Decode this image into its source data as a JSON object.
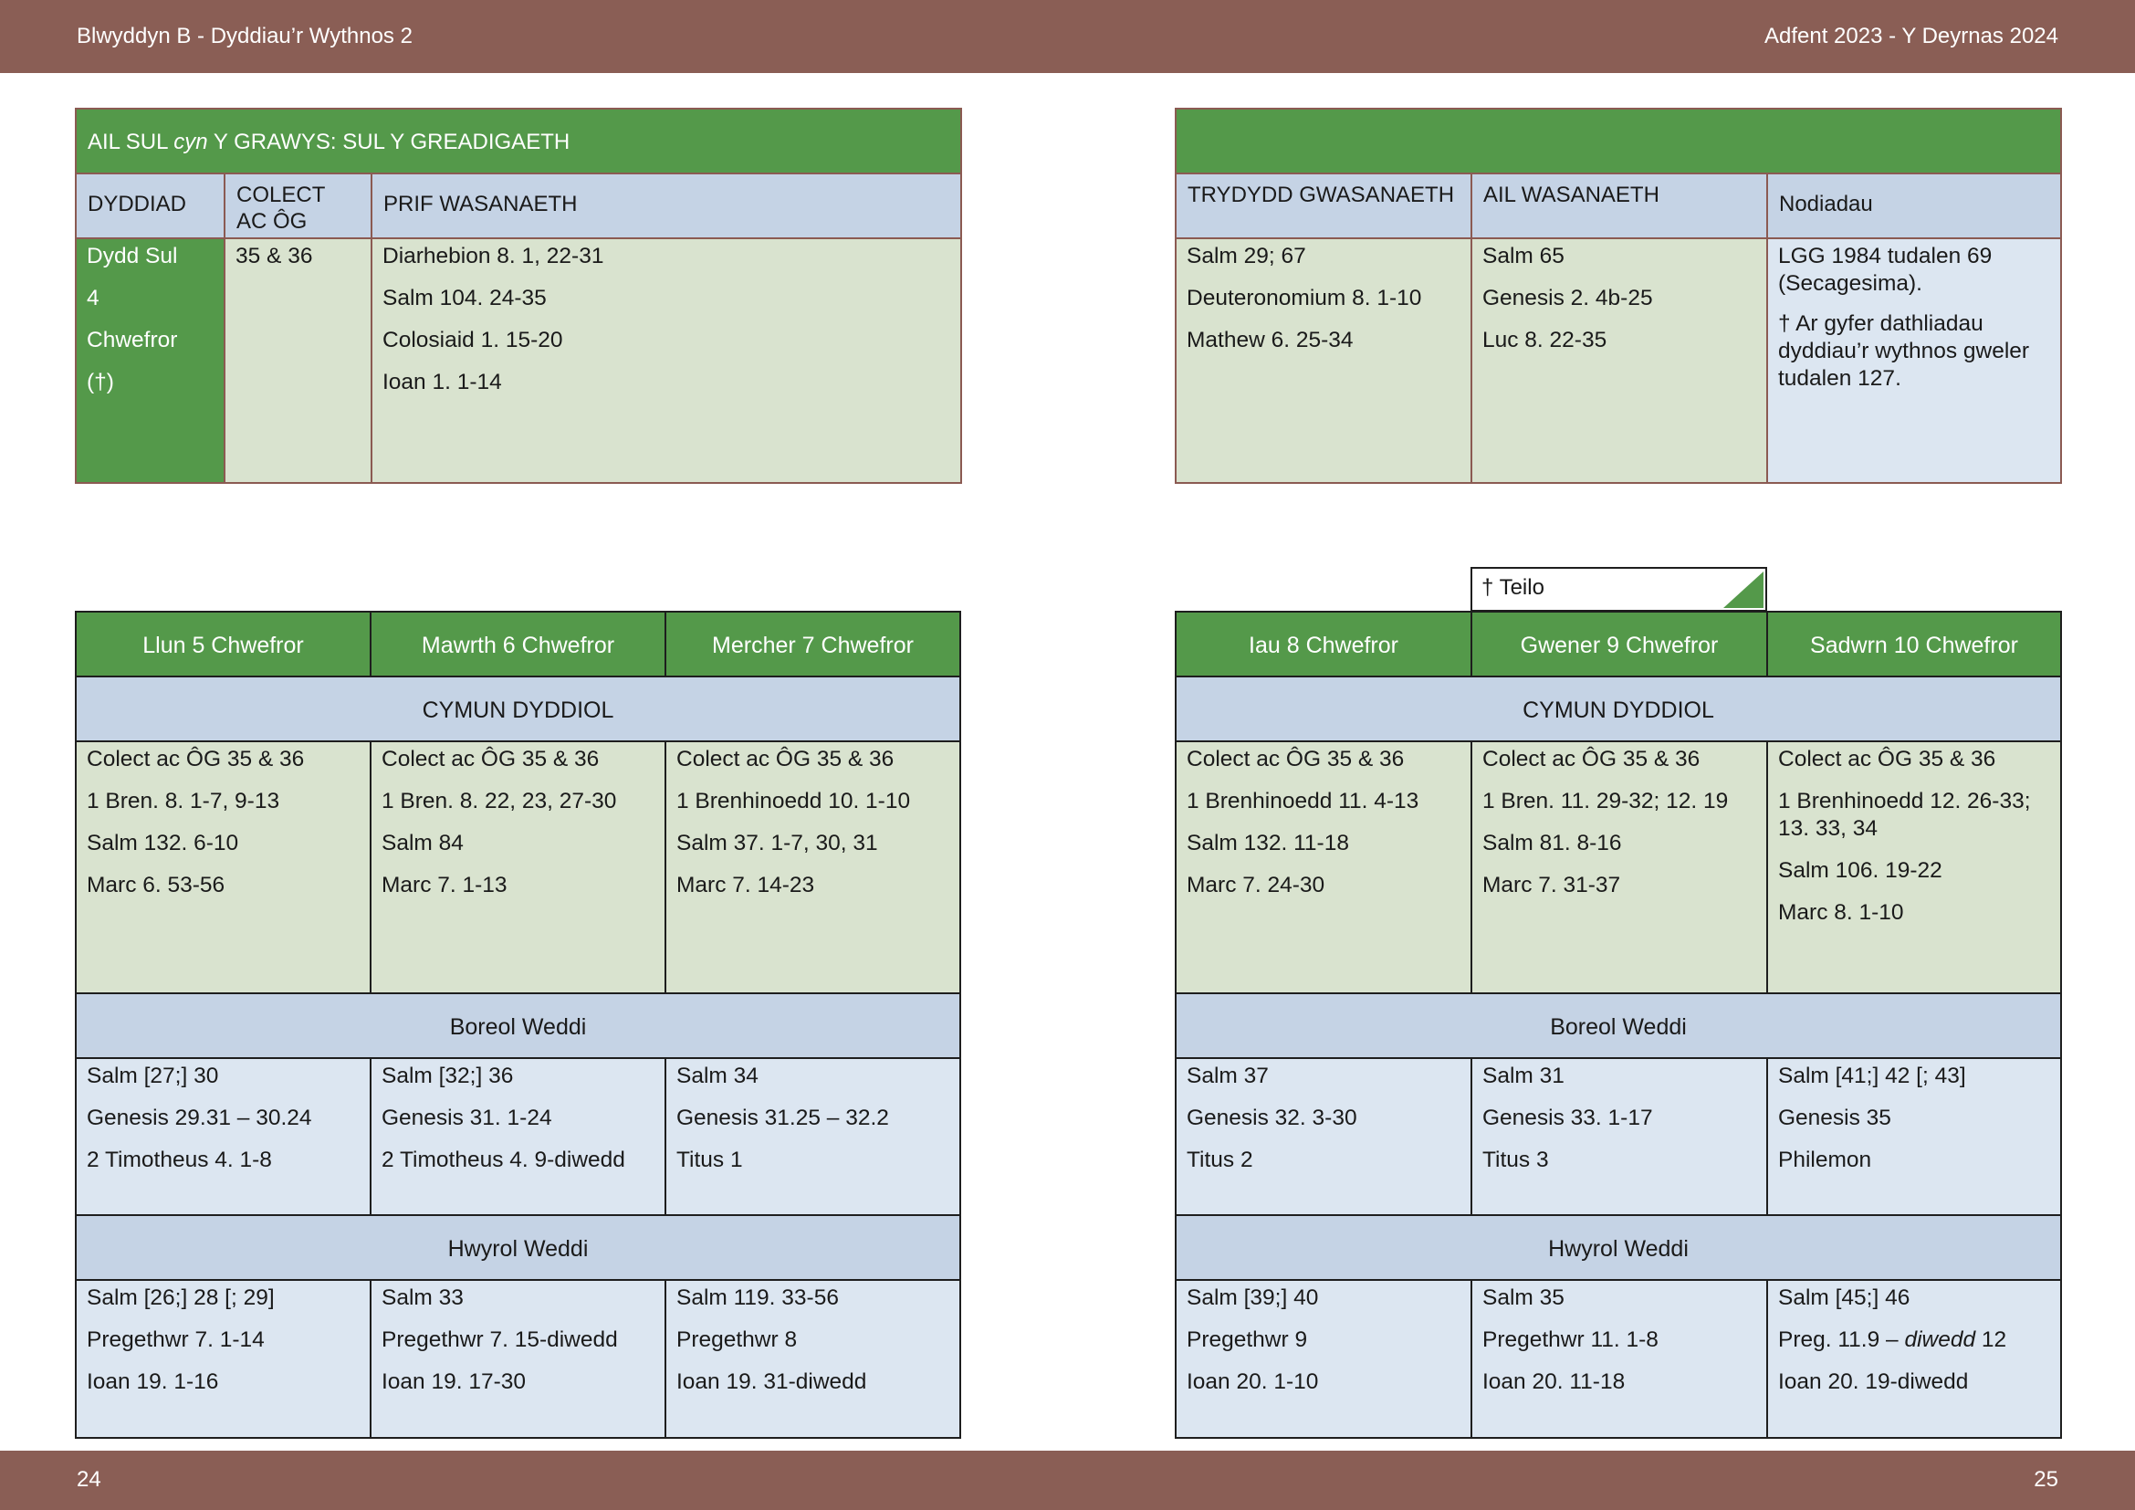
{
  "header": {
    "left": "Blwyddyn  B - Dyddiau’r Wythnos 2",
    "right": "Adfent  2023 - Y Deyrnas 2024"
  },
  "footer": {
    "left": "24",
    "right": "25"
  },
  "sunday": {
    "title_pre": "AIL SUL ",
    "title_em": "cyn",
    "title_post": " Y GRAWYS: SUL Y GREADIGAETH",
    "headers": {
      "date": "DYDDIAD",
      "collect": "COLECT AC ÔG",
      "principal": "PRIF WASANAETH",
      "third": "TRYDYDD GWASANAETH",
      "second": "AIL WASANAETH",
      "notes": "Nodiadau"
    },
    "date_lines": [
      "Dydd Sul",
      "4",
      "Chwefror",
      "(†)"
    ],
    "collect": "35 & 36",
    "principal": [
      "Diarhebion 8. 1, 22-31",
      "Salm 104. 24-35",
      "Colosiaid 1. 15-20",
      "Ioan 1. 1-14"
    ],
    "third": [
      "Salm 29; 67",
      "Deuteronomium 8. 1-10",
      "Mathew 6. 25-34"
    ],
    "second": [
      "Salm 65",
      "Genesis 2. 4b-25",
      "Luc 8. 22-35"
    ],
    "notes": [
      "LGG 1984 tudalen 69 (Secagesima).",
      "† Ar gyfer dathliadau dyddiau’r wythnos gweler tudalen 127."
    ]
  },
  "tab_label": "† Teilo",
  "section_labels": {
    "eucharist": "CYMUN DYDDIOL",
    "morning": "Boreol Weddi",
    "evening": "Hwyrol Weddi"
  },
  "weekdays": [
    {
      "day": "Llun 5 Chwefror",
      "eucharist": [
        "Colect ac ÔG 35 & 36",
        "1 Bren. 8. 1-7, 9-13",
        "Salm 132. 6-10",
        "Marc 6. 53-56"
      ],
      "morning": [
        "Salm [27;] 30",
        "Genesis 29.31 – 30.24",
        "2 Timotheus 4. 1-8"
      ],
      "evening": [
        "Salm [26;] 28 [; 29]",
        "Pregethwr 7. 1-14",
        "Ioan 19. 1-16"
      ]
    },
    {
      "day": "Mawrth 6 Chwefror",
      "eucharist": [
        "Colect ac ÔG 35 & 36",
        "1 Bren. 8. 22, 23, 27-30",
        "Salm 84",
        "Marc 7. 1-13"
      ],
      "morning": [
        "Salm [32;] 36",
        "Genesis 31. 1-24",
        "2 Timotheus 4. 9-diwedd"
      ],
      "evening": [
        "Salm 33",
        "Pregethwr 7. 15-diwedd",
        "Ioan 19. 17-30"
      ]
    },
    {
      "day": "Mercher 7 Chwefror",
      "eucharist": [
        "Colect ac ÔG 35 & 36",
        "1 Brenhinoedd 10. 1-10",
        "Salm 37. 1-7, 30, 31",
        "Marc 7. 14-23"
      ],
      "morning": [
        "Salm 34",
        "Genesis 31.25 – 32.2",
        "Titus 1"
      ],
      "evening": [
        "Salm 119. 33-56",
        "Pregethwr 8",
        "Ioan 19. 31-diwedd"
      ]
    },
    {
      "day": "Iau 8 Chwefror",
      "eucharist": [
        "Colect ac ÔG 35 & 36",
        "1 Brenhinoedd 11. 4-13",
        "Salm 132. 11-18",
        "Marc 7. 24-30"
      ],
      "morning": [
        "Salm 37",
        "Genesis 32. 3-30",
        "Titus 2"
      ],
      "evening": [
        "Salm [39;] 40",
        "Pregethwr 9",
        "Ioan 20. 1-10"
      ]
    },
    {
      "day": "Gwener 9 Chwefror",
      "eucharist": [
        "Colect ac ÔG 35 & 36",
        "1 Bren. 11. 29-32; 12. 19",
        "Salm 81. 8-16",
        "Marc 7. 31-37"
      ],
      "morning": [
        "Salm 31",
        "Genesis 33. 1-17",
        "Titus 3"
      ],
      "evening": [
        "Salm 35",
        "Pregethwr 11. 1-8",
        "Ioan 20. 11-18"
      ]
    },
    {
      "day": "Sadwrn 10 Chwefror",
      "eucharist": [
        "Colect ac ÔG 35 & 36",
        "1 Brenhinoedd 12. 26-33; 13. 33, 34",
        "Salm 106. 19-22",
        "Marc 8. 1-10"
      ],
      "morning": [
        "Salm [41;] 42 [; 43]",
        "Genesis 35",
        "Philemon"
      ],
      "evening_salm": "Salm [45;] 46",
      "evening_preg_pre": "Preg. 11.9 – ",
      "evening_preg_em": "diwedd",
      "evening_preg_post": " 12",
      "evening_ioan": "Ioan 20. 19-diwedd"
    }
  ]
}
